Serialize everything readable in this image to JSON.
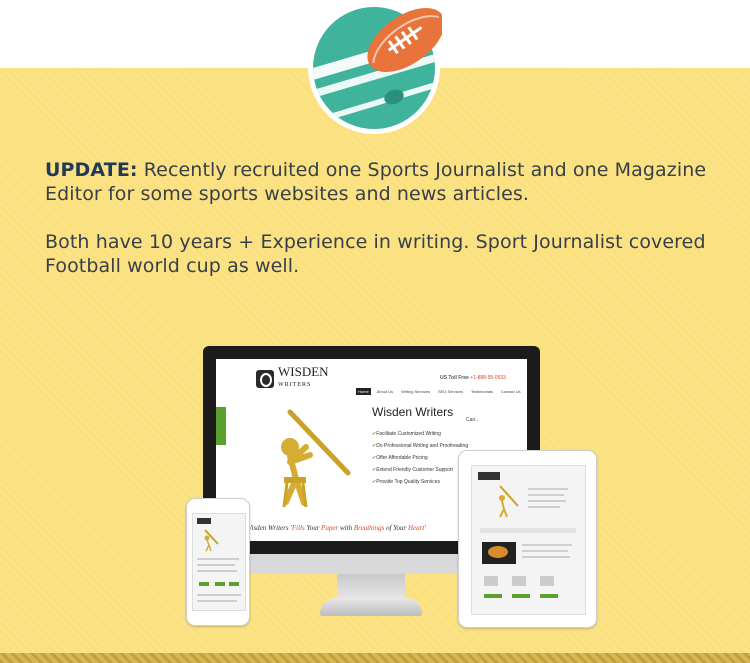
{
  "update": {
    "label": "UPDATE:",
    "line1_text": " Recently recruited one Sports Journalist and one Magazine Editor for some sports websites and news articles.",
    "line2_text": "Both have 10 years + Experience in writing. Sport Journalist covered Football world cup as well."
  },
  "badge": {
    "icon": "american-football-icon",
    "colors": {
      "circle": "#3fb39b",
      "ball": "#e8743b",
      "ring": "#ffffff"
    }
  },
  "mockup_site": {
    "logo_title": "WISDEN",
    "logo_subtitle": "WRITERS",
    "tollfree_label": "US Toll Free",
    "tollfree_number": "+1-888-95-0533",
    "nav": [
      "Home",
      "About Us",
      "Writing Services",
      "SEO Services",
      "Testimonials",
      "Contact Us"
    ],
    "hero_title": "Wisden Writers",
    "hero_sub": "Can..",
    "features": [
      "Facilitate Customized Writing",
      "Do Professional Writing and Proofreading",
      "Offer Affordable Pricing",
      "Extend Friendly Customer Support",
      "Provide Top Quality Services"
    ],
    "tagline_parts": [
      "Wisden Writers '",
      "Fills",
      " Your ",
      "Paper",
      " with ",
      "Breathings",
      " of Your ",
      "Heart",
      "'"
    ]
  },
  "colors": {
    "yellow": "#fbe07e",
    "text": "#37404a",
    "heading": "#223a56",
    "accent_green": "#5aa02c",
    "accent_red": "#d9462b"
  }
}
